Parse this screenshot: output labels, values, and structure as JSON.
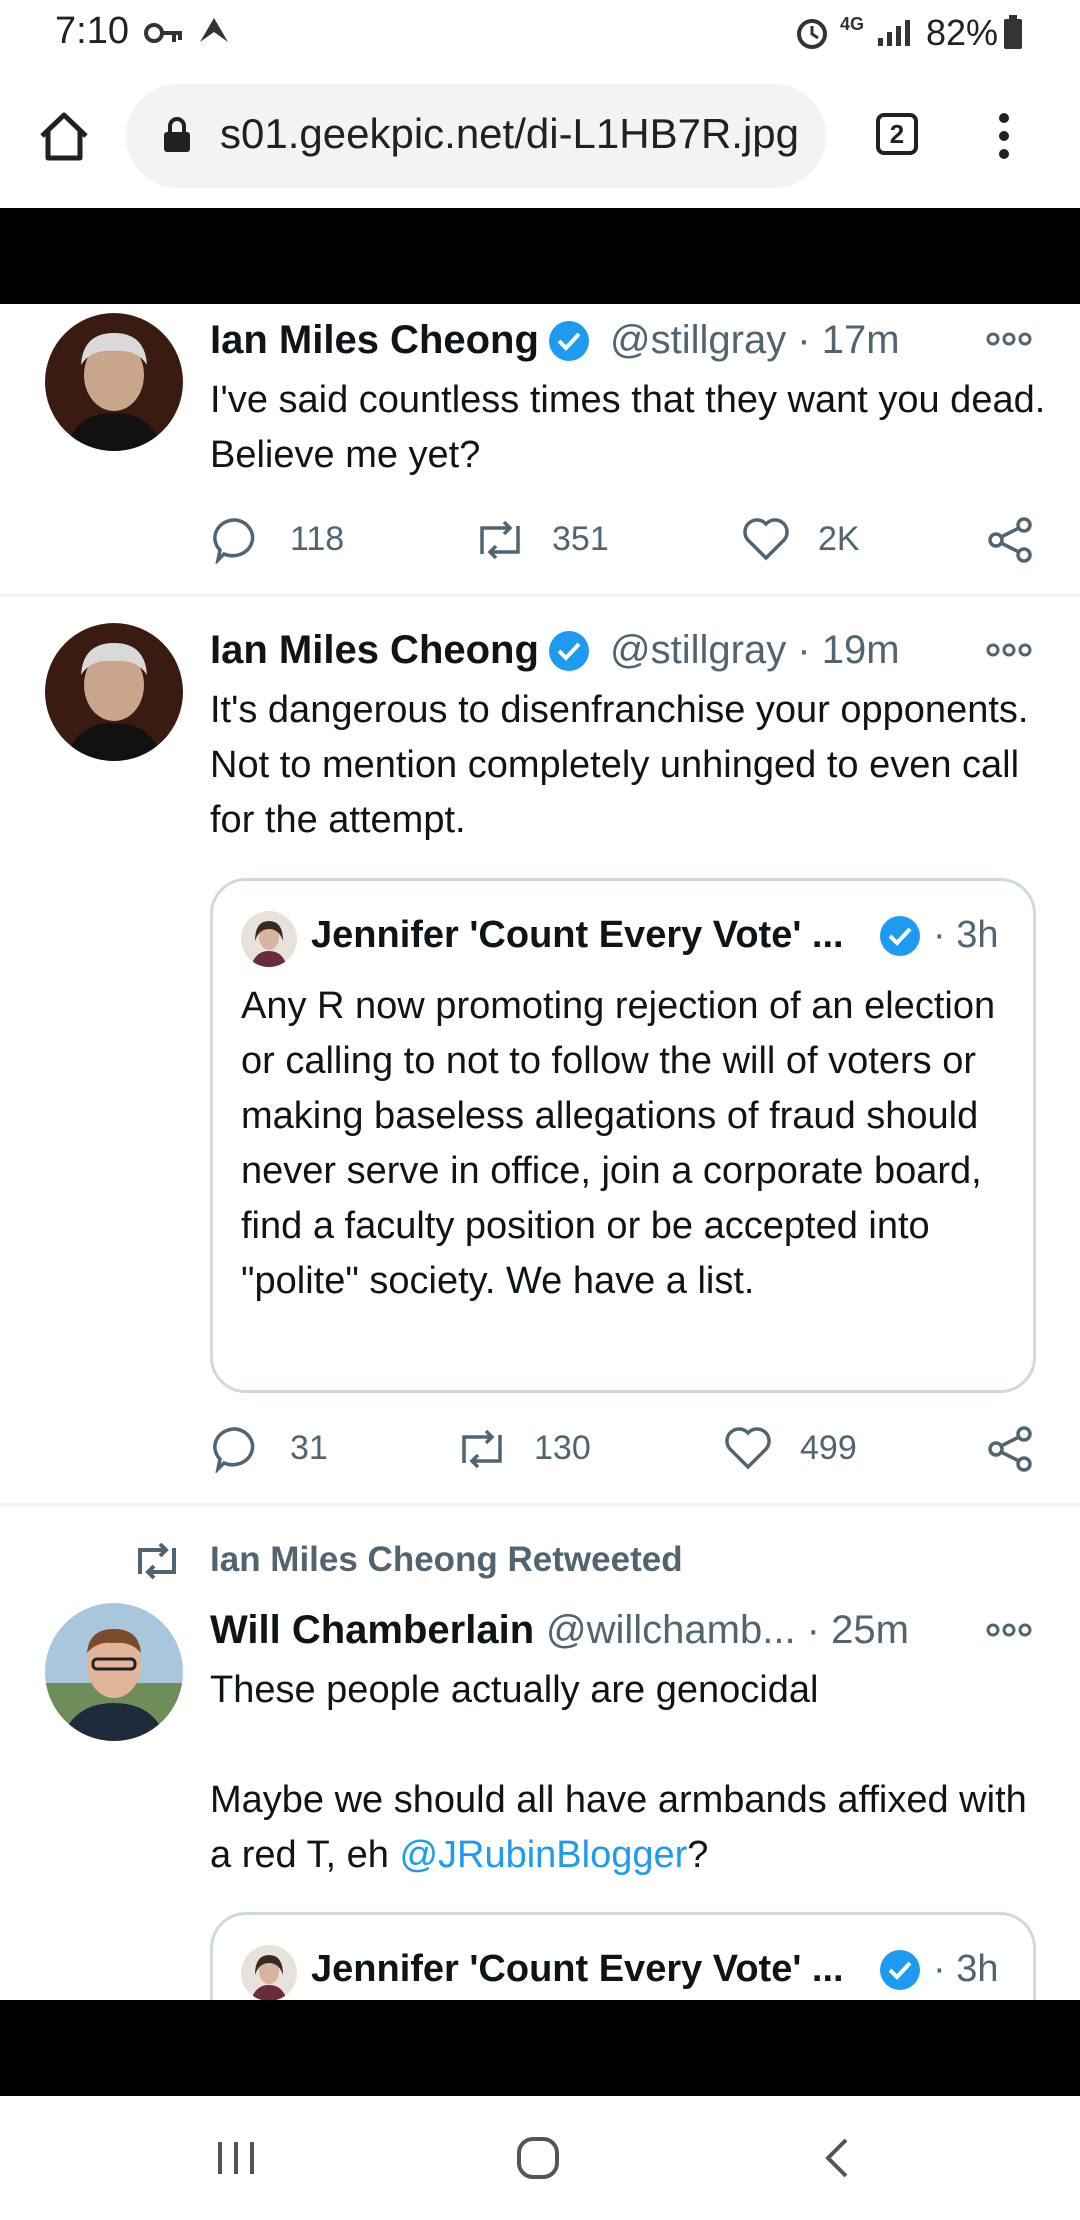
{
  "status_bar": {
    "time": "7:10",
    "network": "4G",
    "battery": "82%",
    "icons": [
      "key-icon",
      "app-icon",
      "alarm-icon",
      "network-icon",
      "signal-icon",
      "battery-icon"
    ]
  },
  "browser": {
    "url": "s01.geekpic.net/di-L1HB7R.jpg",
    "tab_count": "2",
    "icons": [
      "home-icon",
      "lock-icon",
      "more-icon"
    ]
  },
  "tweets": [
    {
      "name": "Ian Miles Cheong",
      "handle_time": "@stillgray · 17m",
      "text": "I've said countless times that they want you dead. Believe me yet?",
      "replies": "118",
      "retweets": "351",
      "likes": "2K"
    },
    {
      "name": "Ian Miles Cheong",
      "handle_time": "@stillgray · 19m",
      "text": "It's dangerous to disenfranchise your opponents. Not to mention completely unhinged to even call for the attempt.",
      "quote": {
        "name": "Jennifer 'Count Every Vote' ...",
        "time": "· 3h",
        "text": "Any R now promoting rejection of an election or calling to not to follow the will of voters or making baseless allegations of fraud should never serve in office, join a corporate board, find a faculty position or be accepted into \"polite\" society. We have a list."
      },
      "replies": "31",
      "retweets": "130",
      "likes": "499"
    },
    {
      "retweeted_by": "Ian Miles Cheong Retweeted",
      "name": "Will Chamberlain",
      "handle_time": "@willchamb... · 25m",
      "text_line1": "These people actually are genocidal",
      "text_line2": "Maybe we should all have armbands affixed with a red T, eh ",
      "mention": "@JRubinBlogger",
      "text_end": "?",
      "quote": {
        "name": "Jennifer 'Count Every Vote' ...",
        "time": "· 3h"
      }
    }
  ],
  "colors": {
    "accent": "#1d9bf0",
    "text": "#0f1419",
    "muted": "#536471",
    "verified": "#1d9bf0"
  },
  "nav_icons": [
    "recents-icon",
    "home-circle-icon",
    "back-icon"
  ]
}
